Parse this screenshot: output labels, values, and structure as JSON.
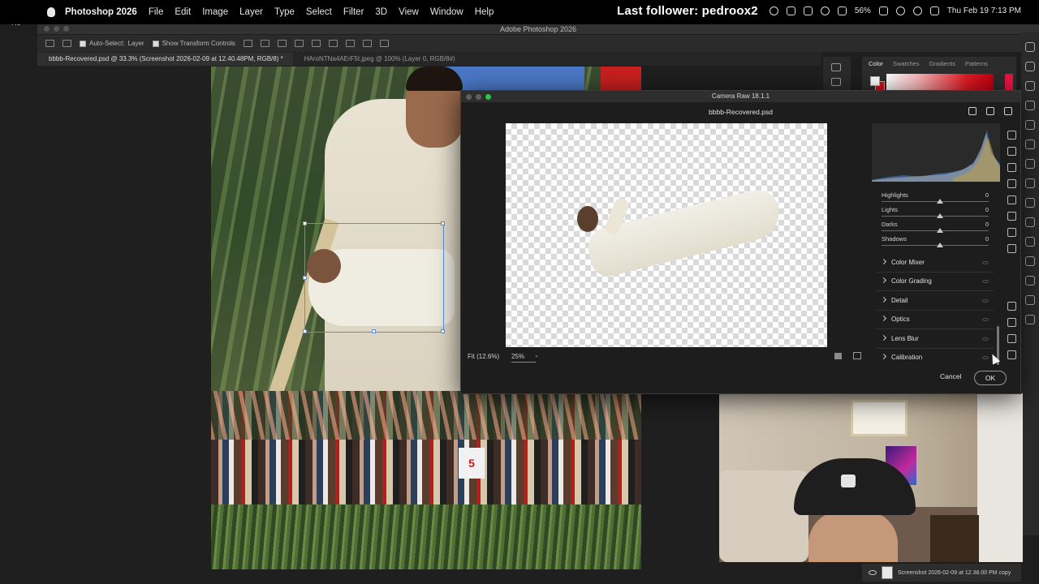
{
  "menubar": {
    "app_name": "Photoshop 2026",
    "menus": [
      "File",
      "Edit",
      "Image",
      "Layer",
      "Type",
      "Select",
      "Filter",
      "3D",
      "View",
      "Window",
      "Help"
    ],
    "stream_overlay": "Last follower: pedroox2",
    "battery": "56%",
    "clock": "Thu Feb 19  7:13 PM"
  },
  "left_stub": {
    "label": "bbbb-Re"
  },
  "ps_window": {
    "title": "Adobe Photoshop 2026"
  },
  "options_bar": {
    "auto_select_label": "Auto-Select:",
    "auto_select_value": "Layer",
    "show_transform_label": "Show Transform Controls"
  },
  "tabs": [
    {
      "label": "bbbb-Recovered.psd @ 33.3% (Screenshot 2026-02-09 at 12.40.48PM, RGB/8) *"
    },
    {
      "label": "HAroNTNa4AErF5t.jpeg @ 100% (Layer 0, RGB/8#)"
    }
  ],
  "canvas": {
    "jersey_number": "5"
  },
  "color_panel": {
    "tabs": [
      "Color",
      "Swatches",
      "Gradients",
      "Patterns"
    ],
    "fg_color": "#ffffff",
    "bg_color": "#d0101b"
  },
  "layers": {
    "row_label": "Screenshot 2026-02-09 at 12.38.00 PM copy"
  },
  "camera_raw": {
    "title": "Camera Raw 18.1.1",
    "file_name": "bbbb-Recovered.psd",
    "fit_label": "Fit (12.6%)",
    "zoom_value": "25%",
    "tone_curve": [
      {
        "label": "Highlights",
        "value": "0"
      },
      {
        "label": "Lights",
        "value": "0"
      },
      {
        "label": "Darks",
        "value": "0"
      },
      {
        "label": "Shadows",
        "value": "0"
      }
    ],
    "sections": [
      "Color Mixer",
      "Color Grading",
      "Detail",
      "Optics",
      "Lens Blur",
      "Calibration"
    ],
    "cancel_label": "Cancel",
    "ok_label": "OK"
  }
}
